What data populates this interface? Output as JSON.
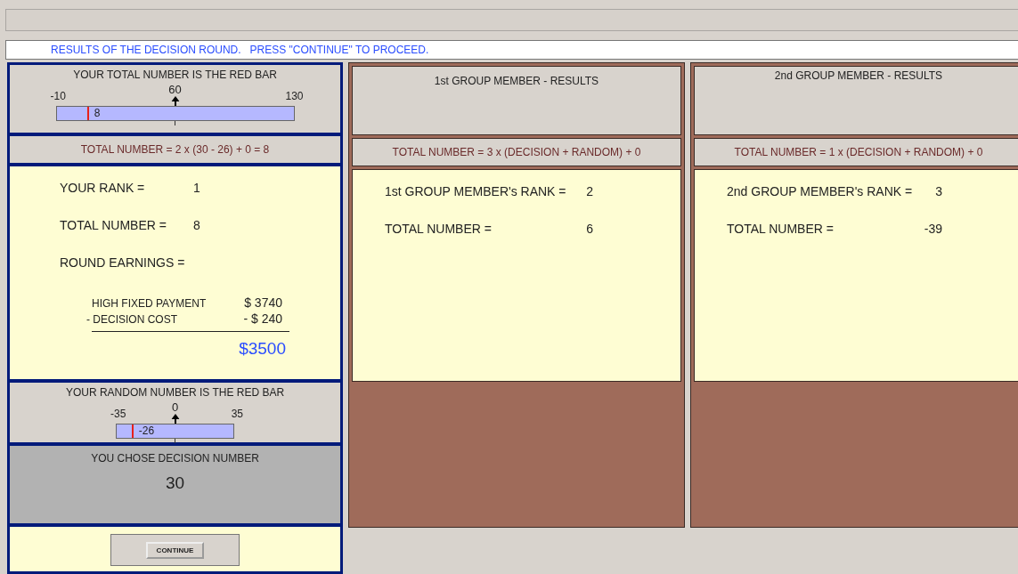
{
  "banner": "RESULTS OF THE DECISION ROUND.   PRESS \"CONTINUE\" TO PROCEED.",
  "you": {
    "total_gauge": {
      "title": "YOUR TOTAL NUMBER IS THE RED BAR",
      "min": "-10",
      "mid": "60",
      "max": "130",
      "value": "8",
      "level": 0.1286
    },
    "formula": "TOTAL NUMBER = 2 x (30 - 26) + 0 = 8",
    "rows": [
      {
        "label": "YOUR RANK =",
        "value": "1"
      },
      {
        "label": "TOTAL NUMBER =",
        "value": "8"
      },
      {
        "label": "ROUND EARNINGS ="
      }
    ],
    "lines": [
      {
        "label": "HIGH FIXED PAYMENT",
        "amount": "$ 3740"
      },
      {
        "label": "- DECISION COST",
        "amount": "- $ 240"
      }
    ],
    "earnings_total": "$3500",
    "random_gauge": {
      "title": "YOUR RANDOM NUMBER IS THE RED BAR",
      "min": "-35",
      "mid": "0",
      "max": "35",
      "value": "-26",
      "level": 0.1286
    },
    "decision_label": "YOU CHOSE DECISION NUMBER",
    "decision": "30",
    "continue": "CONTINUE"
  },
  "members": [
    {
      "title": "1st GROUP MEMBER - RESULTS",
      "formula": "TOTAL NUMBER = 3 x (DECISION + RANDOM) + 0",
      "rows": [
        {
          "label": "1st GROUP MEMBER's RANK =",
          "value": "2"
        },
        {
          "label": "TOTAL NUMBER =",
          "value": "6"
        }
      ]
    },
    {
      "title": "2nd GROUP MEMBER - RESULTS",
      "formula": "TOTAL NUMBER = 1 x (DECISION + RANDOM) + 0",
      "rows": [
        {
          "label": "2nd GROUP MEMBER's RANK =",
          "value": "3"
        },
        {
          "label": "TOTAL NUMBER =",
          "value": "-39"
        }
      ]
    }
  ]
}
